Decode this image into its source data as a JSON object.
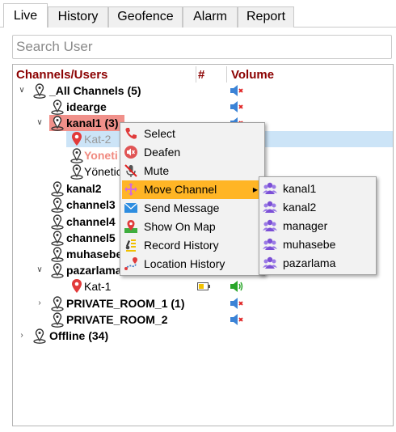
{
  "tabs": [
    {
      "label": "Live",
      "active": true
    },
    {
      "label": "History"
    },
    {
      "label": "Geofence"
    },
    {
      "label": "Alarm"
    },
    {
      "label": "Report"
    }
  ],
  "search": {
    "placeholder": "Search User",
    "value": ""
  },
  "columns": {
    "name": "Channels/Users",
    "count": "#",
    "volume": "Volume"
  },
  "tree": {
    "all_channels": "_All Channels (5)",
    "idearge": "idearge",
    "kanal1": "kanal1 (3)",
    "kat2": "Kat-2",
    "yonetici_red": "Yoneti",
    "yonetici": "Yönetic",
    "kanal2": "kanal2",
    "channel3": "channel3",
    "channel4": "channel4",
    "channel5": "channel5",
    "muhasebe": "muhasebe",
    "pazarlama": "pazarlama",
    "kat1": "Kat-1",
    "private1": "PRIVATE_ROOM_1 (1)",
    "private2": "PRIVATE_ROOM_2",
    "offline": "Offline (34)"
  },
  "context_menu": {
    "items": [
      {
        "label": "Select",
        "icon": "phone-icon"
      },
      {
        "label": "Deafen",
        "icon": "deafen-icon"
      },
      {
        "label": "Mute",
        "icon": "mute-mic-icon"
      },
      {
        "label": "Move Channel",
        "icon": "move-icon",
        "submenu": true,
        "highlighted": true
      },
      {
        "label": "Send Message",
        "icon": "envelope-icon"
      },
      {
        "label": "Show On Map",
        "icon": "map-pin-icon"
      },
      {
        "label": "Record History",
        "icon": "record-history-icon"
      },
      {
        "label": "Location History",
        "icon": "location-history-icon"
      }
    ]
  },
  "move_channel_submenu": {
    "items": [
      "kanal1",
      "kanal2",
      "manager",
      "muhasebe",
      "pazarlama"
    ]
  },
  "colors": {
    "header_text": "#8b0000",
    "highlight_red": "#f0908a",
    "highlight_orange": "#ffb525",
    "selected_blue": "#cce4f7",
    "speaker_blue": "#3b83d6",
    "mute_red": "#e02020",
    "speaker_green": "#2aa62a"
  }
}
